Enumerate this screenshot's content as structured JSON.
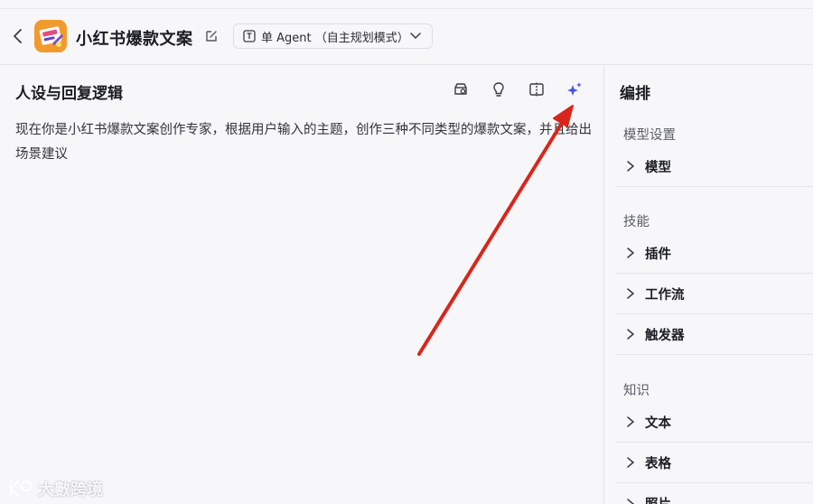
{
  "header": {
    "app_title": "小红书爆款文案",
    "mode_select": {
      "value": "单 Agent （自主规划模式）"
    }
  },
  "left_panel": {
    "title": "人设与回复逻辑",
    "prompt_text": "现在你是小红书爆款文案创作专家，根据用户输入的主题，创作三种不同类型的爆款文案，并且给出场景建议",
    "tools": [
      "history-icon",
      "lightbulb-icon",
      "split-view-icon",
      "ai-sparkle-icon"
    ]
  },
  "right_panel": {
    "title": "编排",
    "sections": [
      {
        "label": "模型设置",
        "items": [
          "模型"
        ]
      },
      {
        "label": "技能",
        "items": [
          "插件",
          "工作流",
          "触发器"
        ]
      },
      {
        "label": "知识",
        "items": [
          "文本",
          "表格",
          "照片"
        ]
      }
    ]
  },
  "watermark": {
    "text": "大數跨境"
  },
  "colors": {
    "accent": "#4d53e8",
    "arrow": "#d9261c",
    "app_icon": "#f29a2e"
  }
}
